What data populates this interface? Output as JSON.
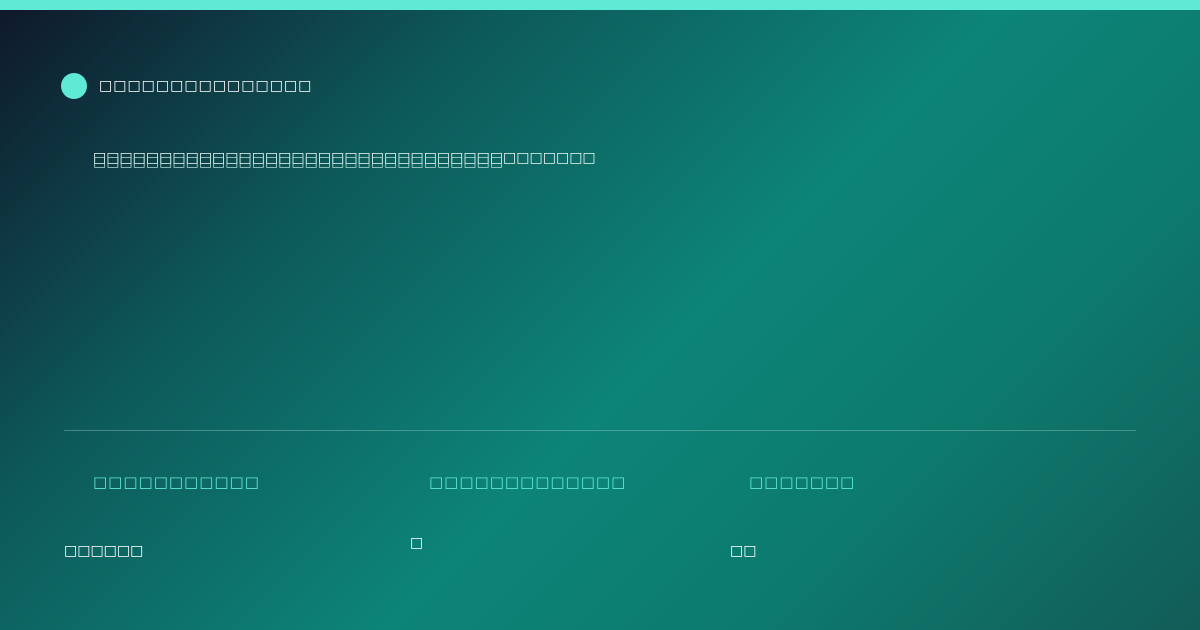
{
  "brand": {
    "name": "□□□□□□□□□□□□□□□",
    "dot_color": "#5eead4"
  },
  "headline": {
    "line1": "□□□□□□□□□□□□□□□□□□□□□□□□□□□□□□□□□□□□□□",
    "line2": "□□□□□□□□□□□□□□□□□□□□□□□□□□□□□□□"
  },
  "stats": [
    {
      "label": "□□□□□□□□□□□",
      "value": "□□□□□□"
    },
    {
      "label": "□□□□□□□□□□□□□",
      "value": "□"
    },
    {
      "label": "□□□□□□□",
      "value": "□□"
    }
  ],
  "colors": {
    "accent": "#5eead4",
    "background_start": "#0f172a",
    "background_mid": "#0d8478",
    "background_end": "#125c58"
  }
}
